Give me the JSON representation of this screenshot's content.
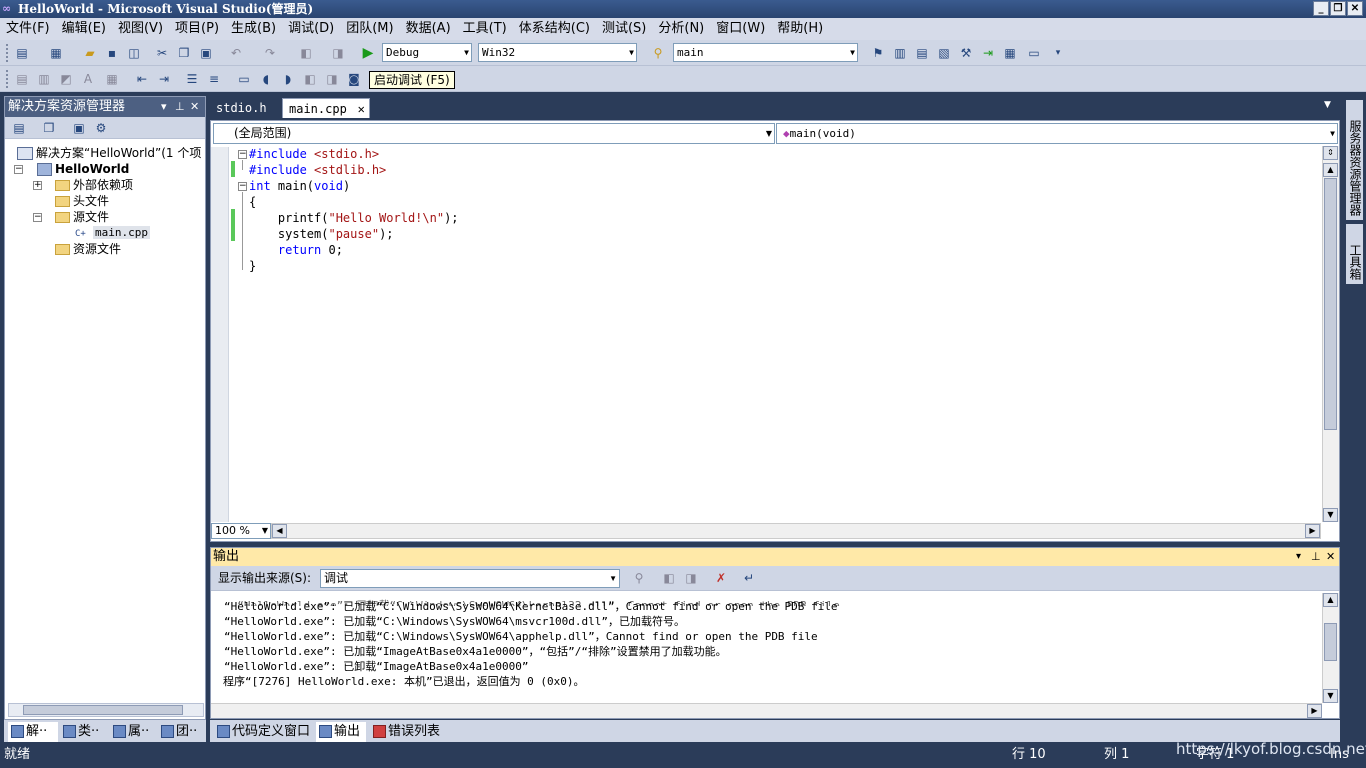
{
  "window": {
    "title": "HelloWorld - Microsoft Visual Studio(管理员)"
  },
  "menu": [
    "文件(F)",
    "编辑(E)",
    "视图(V)",
    "项目(P)",
    "生成(B)",
    "调试(D)",
    "团队(M)",
    "数据(A)",
    "工具(T)",
    "体系结构(C)",
    "测试(S)",
    "分析(N)",
    "窗口(W)",
    "帮助(H)"
  ],
  "toolbar": {
    "config": "Debug",
    "platform": "Win32",
    "find": "main",
    "tooltip": "启动调试 (F5)"
  },
  "solution_explorer": {
    "title": "解决方案资源管理器",
    "solution": "解决方案“HelloWorld”(1 个项",
    "project": "HelloWorld",
    "nodes": [
      "外部依赖项",
      "头文件",
      "源文件",
      "main.cpp",
      "资源文件"
    ]
  },
  "left_tabs": [
    "解··",
    "类··",
    "属··",
    "团··"
  ],
  "doc_tabs": [
    "stdio.h",
    "main.cpp"
  ],
  "editor": {
    "scope": "(全局范围)",
    "member": "main(void)",
    "zoom": "100 %",
    "lines": [
      "#include <stdio.h>",
      "#include <stdlib.h>",
      "int main(void)",
      "{",
      "    printf(\"Hello World!\\n\");",
      "    system(\"pause\");",
      "    return 0;",
      "}"
    ]
  },
  "output": {
    "title": "输出",
    "source_label": "显示输出来源(S):",
    "source_value": "调试",
    "lines": [
      "“HelloWorld.exe”: 已加载“C:\\Windows\\SysWOW64\\KernelBase.dll”，Cannot find or open the PDB file",
      "“HelloWorld.exe”: 已加载“C:\\Windows\\SysWOW64\\msvcr100d.dll”，已加载符号。",
      "“HelloWorld.exe”: 已加载“C:\\Windows\\SysWOW64\\apphelp.dll”，Cannot find or open the PDB file",
      "“HelloWorld.exe”: 已加载“ImageAtBase0x4a1e0000”，“包括”/“排除”设置禁用了加载功能。",
      "“HelloWorld.exe”: 已卸载“ImageAtBase0x4a1e0000”",
      "程序“[7276] HelloWorld.exe: 本机”已退出，返回值为 0 (0x0)。"
    ]
  },
  "bottom_tabs": [
    "代码定义窗口",
    "输出",
    "错误列表"
  ],
  "right_tabs": [
    "服务器资源管理器",
    "工具箱"
  ],
  "status": {
    "ready": "就绪",
    "line": "行 10",
    "col": "列 1",
    "char": "字符 1",
    "ins": "Ins",
    "watermark": "https://lkyof.blog.csdn.net"
  }
}
